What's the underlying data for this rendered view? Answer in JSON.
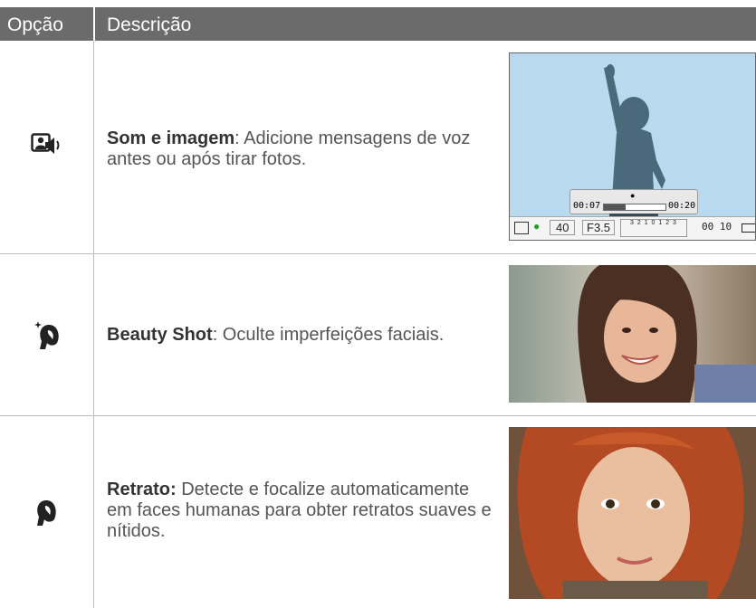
{
  "header": {
    "col_option": "Opção",
    "col_description": "Descrição"
  },
  "rows": [
    {
      "icon": "voice-memo-icon",
      "title": "Som e imagem",
      "text": ": Adicione mensagens de voz antes ou após tirar fotos."
    },
    {
      "icon": "beauty-shot-icon",
      "title": "Beauty Shot",
      "text": ": Oculte imperfeições faciais."
    },
    {
      "icon": "portrait-icon",
      "title": "Retrato:",
      "text": " Detecte e focalize automaticamente em faces humanas para obter retratos suaves e nítidos."
    }
  ],
  "camera_screen": {
    "time_start": "00:07",
    "time_end": "00:20",
    "progress": 0.35,
    "iso": "40",
    "aperture": "F3.5",
    "exposure_scale": "3 2 1 0 1 2 3",
    "shots": "00 10"
  }
}
